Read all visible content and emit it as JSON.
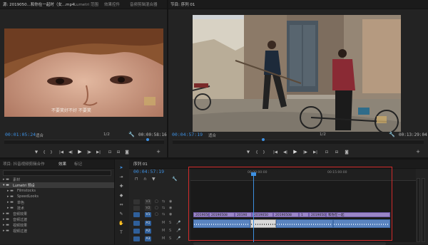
{
  "source_panel": {
    "tabs": [
      {
        "label": "源: 2019050...和你在一起时（女...mp4",
        "active": true
      },
      {
        "label": "Lumetri 范围",
        "active": false
      },
      {
        "label": "效果控件",
        "active": false
      },
      {
        "label": "音频剪辑混合器",
        "active": false
      }
    ],
    "timecode_in": "00:01:05:24",
    "fit_label": "适合",
    "scale_label": "1/2",
    "duration": "00:00:58:16",
    "subtitle": "不要笑好不好 不要笑"
  },
  "program_panel": {
    "title": "节目: 序列 01",
    "timecode": "00:04:57:19",
    "fit_label": "适合",
    "scale_label": "1/2",
    "duration": "00:13:29:04"
  },
  "project_panel": {
    "tabs": [
      {
        "label": "项目: 抖音视频剪辑合作",
        "active": true
      },
      {
        "label": "效果",
        "active": false
      },
      {
        "label": "标记",
        "active": false
      }
    ],
    "items": [
      {
        "label": "素材",
        "indent": 0
      },
      {
        "label": "Lumetri 预设",
        "indent": 1
      },
      {
        "label": "Filmstocks",
        "indent": 2
      },
      {
        "label": "SpeedLooks",
        "indent": 2
      },
      {
        "label": "单色",
        "indent": 2
      },
      {
        "label": "技术",
        "indent": 2
      },
      {
        "label": "音频效果",
        "indent": 0
      },
      {
        "label": "音频过渡",
        "indent": 0
      },
      {
        "label": "视频效果",
        "indent": 0
      },
      {
        "label": "视频过渡",
        "indent": 0
      }
    ]
  },
  "timeline": {
    "tab_label": "序列 01",
    "timecode": "00:04:57:19",
    "ruler_marks": [
      "00:00:00:00",
      "00:15:00:00"
    ],
    "tracks": [
      {
        "name": "V3",
        "type": "video"
      },
      {
        "name": "V2",
        "type": "video"
      },
      {
        "name": "V1",
        "type": "video"
      },
      {
        "name": "A1",
        "type": "audio"
      },
      {
        "name": "A2",
        "type": "audio"
      },
      {
        "name": "A3",
        "type": "audio"
      }
    ],
    "video_clips": [
      "2019050",
      "20190508",
      "20190",
      "2019050",
      "20190508",
      "1",
      "20190508",
      "和你在一起"
    ],
    "highlight_color": "#d12a2a",
    "playhead_color": "#3d8fe0"
  },
  "tools": [
    "selection-tool",
    "track-select-tool",
    "ripple-edit-tool",
    "razor-tool",
    "slip-tool",
    "pen-tool",
    "hand-tool",
    "type-tool"
  ]
}
